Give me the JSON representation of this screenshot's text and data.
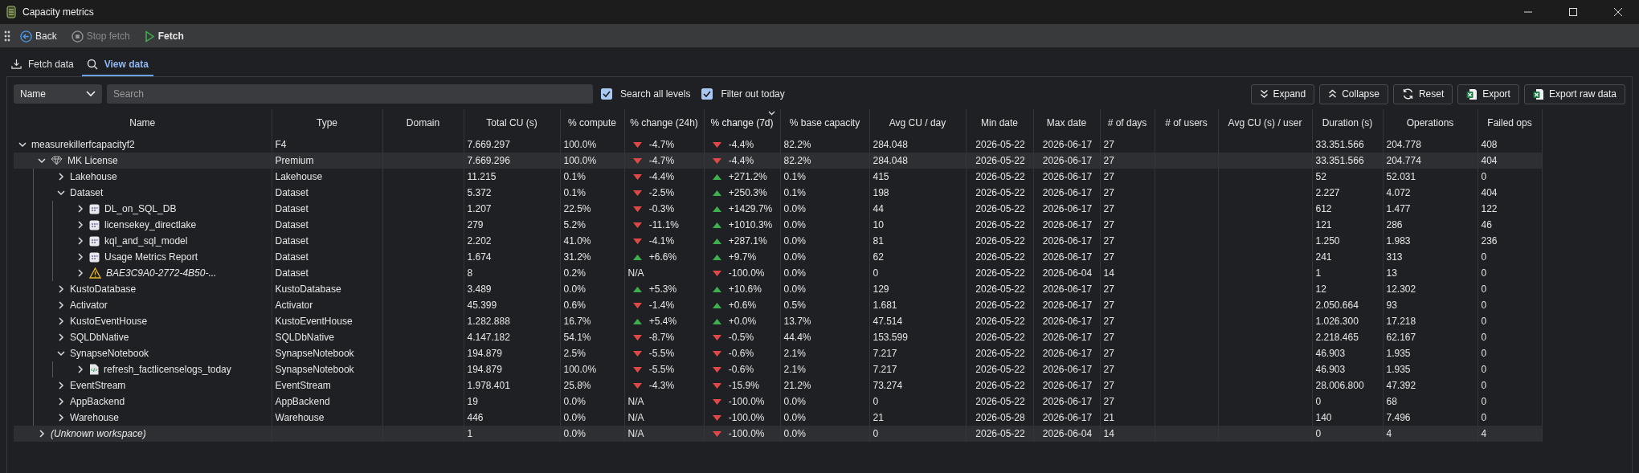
{
  "window": {
    "title": "Capacity metrics"
  },
  "toolbar": [
    {
      "label": "Back",
      "kind": "back",
      "disabled": false,
      "bold": false
    },
    {
      "label": "Stop fetch",
      "kind": "stop",
      "disabled": true,
      "bold": false
    },
    {
      "label": "Fetch",
      "kind": "fetch",
      "disabled": false,
      "bold": true
    }
  ],
  "tabs": [
    {
      "label": "Fetch data",
      "kind": "download",
      "selected": false
    },
    {
      "label": "View data",
      "kind": "search",
      "selected": true
    }
  ],
  "filter": {
    "field": "Name",
    "search_placeholder": "Search",
    "checkboxes": [
      {
        "label": "Search all levels",
        "checked": true
      },
      {
        "label": "Filter out today",
        "checked": true
      }
    ]
  },
  "actions": [
    {
      "label": "Expand",
      "kind": "expand"
    },
    {
      "label": "Collapse",
      "kind": "collapse"
    },
    {
      "label": "Reset",
      "kind": "reset"
    },
    {
      "label": "Export",
      "kind": "excel"
    },
    {
      "label": "Export raw data",
      "kind": "excel"
    }
  ],
  "table": {
    "columns": [
      {
        "label": "Name",
        "sorted": false
      },
      {
        "label": "Type",
        "sorted": false
      },
      {
        "label": "Domain",
        "sorted": false
      },
      {
        "label": "Total CU (s)",
        "sorted": false
      },
      {
        "label": "% compute",
        "sorted": false
      },
      {
        "label": "% change (24h)",
        "sorted": false
      },
      {
        "label": "% change (7d)",
        "sorted": true
      },
      {
        "label": "% base capacity",
        "sorted": false
      },
      {
        "label": "Avg CU / day",
        "sorted": false
      },
      {
        "label": "Min date",
        "sorted": false
      },
      {
        "label": "Max date",
        "sorted": false
      },
      {
        "label": "# of days",
        "sorted": false
      },
      {
        "label": "# of users",
        "sorted": false
      },
      {
        "label": "Avg CU (s) / user",
        "sorted": false
      },
      {
        "label": "Duration (s)",
        "sorted": false
      },
      {
        "label": "Operations",
        "sorted": false
      },
      {
        "label": "Failed ops",
        "sorted": false
      }
    ],
    "rows": [
      {
        "name": "measurekillerfcapacityf2",
        "expanded": true,
        "selected": false,
        "type": "F4",
        "total_cu": "7.669.297",
        "compute": "100.0%",
        "change_24h": {
          "text": "-4.7%",
          "rising": false
        },
        "change_7d": {
          "text": "-4.4%",
          "rising": false
        },
        "base_capacity": "82.2%",
        "avg_cu_day": "284.048",
        "min_date": "2026-05-22",
        "max_date": "2026-06-17",
        "days": "27",
        "duration": "33.351.566",
        "operations": "204.778",
        "failed_ops": "408",
        "children": [
          {
            "name": "MK License",
            "kind": "license",
            "expanded": true,
            "selected": true,
            "type": "Premium",
            "total_cu": "7.669.296",
            "compute": "100.0%",
            "change_24h": {
              "text": "-4.7%",
              "rising": false
            },
            "change_7d": {
              "text": "-4.4%",
              "rising": false
            },
            "base_capacity": "82.2%",
            "avg_cu_day": "284.048",
            "min_date": "2026-05-22",
            "max_date": "2026-06-17",
            "days": "27",
            "duration": "33.351.566",
            "operations": "204.774",
            "failed_ops": "404",
            "children": [
              {
                "name": "Lakehouse",
                "expanded": false,
                "selected": false,
                "type": "Lakehouse",
                "total_cu": "11.215",
                "compute": "0.1%",
                "change_24h": {
                  "text": "-4.4%",
                  "rising": false
                },
                "change_7d": {
                  "text": "+271.2%",
                  "rising": true
                },
                "base_capacity": "0.1%",
                "avg_cu_day": "415",
                "min_date": "2026-05-22",
                "max_date": "2026-06-17",
                "days": "27",
                "duration": "52",
                "operations": "52.031",
                "failed_ops": "0"
              },
              {
                "name": "Dataset",
                "expanded": true,
                "selected": false,
                "type": "Dataset",
                "total_cu": "5.372",
                "compute": "0.1%",
                "change_24h": {
                  "text": "-2.5%",
                  "rising": false
                },
                "change_7d": {
                  "text": "+250.3%",
                  "rising": true
                },
                "base_capacity": "0.1%",
                "avg_cu_day": "198",
                "min_date": "2026-05-22",
                "max_date": "2026-06-17",
                "days": "27",
                "duration": "2.227",
                "operations": "4.072",
                "failed_ops": "404",
                "children": [
                  {
                    "name": "DL_on_SQL_DB",
                    "kind": "model",
                    "expanded": false,
                    "selected": false,
                    "type": "Dataset",
                    "total_cu": "1.207",
                    "compute": "22.5%",
                    "change_24h": {
                      "text": "-0.3%",
                      "rising": false
                    },
                    "change_7d": {
                      "text": "+1429.7%",
                      "rising": true
                    },
                    "base_capacity": "0.0%",
                    "avg_cu_day": "44",
                    "min_date": "2026-05-22",
                    "max_date": "2026-06-17",
                    "days": "27",
                    "duration": "612",
                    "operations": "1.477",
                    "failed_ops": "122"
                  },
                  {
                    "name": "licensekey_directlake",
                    "kind": "model",
                    "expanded": false,
                    "selected": false,
                    "type": "Dataset",
                    "total_cu": "279",
                    "compute": "5.2%",
                    "change_24h": {
                      "text": "-11.1%",
                      "rising": false
                    },
                    "change_7d": {
                      "text": "+1010.3%",
                      "rising": true
                    },
                    "base_capacity": "0.0%",
                    "avg_cu_day": "10",
                    "min_date": "2026-05-22",
                    "max_date": "2026-06-17",
                    "days": "27",
                    "duration": "121",
                    "operations": "286",
                    "failed_ops": "46"
                  },
                  {
                    "name": "kql_and_sql_model",
                    "kind": "model",
                    "expanded": false,
                    "selected": false,
                    "type": "Dataset",
                    "total_cu": "2.202",
                    "compute": "41.0%",
                    "change_24h": {
                      "text": "-4.1%",
                      "rising": false
                    },
                    "change_7d": {
                      "text": "+287.1%",
                      "rising": true
                    },
                    "base_capacity": "0.0%",
                    "avg_cu_day": "81",
                    "min_date": "2026-05-22",
                    "max_date": "2026-06-17",
                    "days": "27",
                    "duration": "1.250",
                    "operations": "1.983",
                    "failed_ops": "236"
                  },
                  {
                    "name": "Usage Metrics Report",
                    "kind": "model",
                    "expanded": false,
                    "selected": false,
                    "type": "Dataset",
                    "total_cu": "1.674",
                    "compute": "31.2%",
                    "change_24h": {
                      "text": "+6.6%",
                      "rising": true
                    },
                    "change_7d": {
                      "text": "+9.7%",
                      "rising": true
                    },
                    "base_capacity": "0.0%",
                    "avg_cu_day": "62",
                    "min_date": "2026-05-22",
                    "max_date": "2026-06-17",
                    "days": "27",
                    "duration": "241",
                    "operations": "313",
                    "failed_ops": "0"
                  },
                  {
                    "name": "BAE3C9A0-2772-4B50-...",
                    "kind": "warning",
                    "expanded": false,
                    "selected": false,
                    "type": "Dataset",
                    "total_cu": "8",
                    "compute": "0.2%",
                    "change_24h": {
                      "text": "N/A"
                    },
                    "change_7d": {
                      "text": "-100.0%",
                      "rising": false
                    },
                    "base_capacity": "0.0%",
                    "avg_cu_day": "0",
                    "min_date": "2026-05-22",
                    "max_date": "2026-06-04",
                    "days": "14",
                    "duration": "1",
                    "operations": "13",
                    "failed_ops": "0"
                  }
                ]
              },
              {
                "name": "KustoDatabase",
                "expanded": false,
                "selected": false,
                "type": "KustoDatabase",
                "total_cu": "3.489",
                "compute": "0.0%",
                "change_24h": {
                  "text": "+5.3%",
                  "rising": true
                },
                "change_7d": {
                  "text": "+10.6%",
                  "rising": true
                },
                "base_capacity": "0.0%",
                "avg_cu_day": "129",
                "min_date": "2026-05-22",
                "max_date": "2026-06-17",
                "days": "27",
                "duration": "12",
                "operations": "12.302",
                "failed_ops": "0"
              },
              {
                "name": "Activator",
                "expanded": false,
                "selected": false,
                "type": "Activator",
                "total_cu": "45.399",
                "compute": "0.6%",
                "change_24h": {
                  "text": "-1.4%",
                  "rising": false
                },
                "change_7d": {
                  "text": "+0.6%",
                  "rising": true
                },
                "base_capacity": "0.5%",
                "avg_cu_day": "1.681",
                "min_date": "2026-05-22",
                "max_date": "2026-06-17",
                "days": "27",
                "duration": "2.050.664",
                "operations": "93",
                "failed_ops": "0"
              },
              {
                "name": "KustoEventHouse",
                "expanded": false,
                "selected": false,
                "type": "KustoEventHouse",
                "total_cu": "1.282.888",
                "compute": "16.7%",
                "change_24h": {
                  "text": "+5.4%",
                  "rising": true
                },
                "change_7d": {
                  "text": "+0.0%",
                  "rising": true
                },
                "base_capacity": "13.7%",
                "avg_cu_day": "47.514",
                "min_date": "2026-05-22",
                "max_date": "2026-06-17",
                "days": "27",
                "duration": "1.026.300",
                "operations": "17.218",
                "failed_ops": "0"
              },
              {
                "name": "SQLDbNative",
                "expanded": false,
                "selected": false,
                "type": "SQLDbNative",
                "total_cu": "4.147.182",
                "compute": "54.1%",
                "change_24h": {
                  "text": "-8.7%",
                  "rising": false
                },
                "change_7d": {
                  "text": "-0.5%",
                  "rising": false
                },
                "base_capacity": "44.4%",
                "avg_cu_day": "153.599",
                "min_date": "2026-05-22",
                "max_date": "2026-06-17",
                "days": "27",
                "duration": "2.218.465",
                "operations": "62.167",
                "failed_ops": "0"
              },
              {
                "name": "SynapseNotebook",
                "expanded": true,
                "selected": false,
                "type": "SynapseNotebook",
                "total_cu": "194.879",
                "compute": "2.5%",
                "change_24h": {
                  "text": "-5.5%",
                  "rising": false
                },
                "change_7d": {
                  "text": "-0.6%",
                  "rising": false
                },
                "base_capacity": "2.1%",
                "avg_cu_day": "7.217",
                "min_date": "2026-05-22",
                "max_date": "2026-06-17",
                "days": "27",
                "duration": "46.903",
                "operations": "1.935",
                "failed_ops": "0",
                "children": [
                  {
                    "name": "refresh_factlicenselogs_today",
                    "kind": "notebook",
                    "expanded": false,
                    "selected": false,
                    "type": "SynapseNotebook",
                    "total_cu": "194.879",
                    "compute": "100.0%",
                    "change_24h": {
                      "text": "-5.5%",
                      "rising": false
                    },
                    "change_7d": {
                      "text": "-0.6%",
                      "rising": false
                    },
                    "base_capacity": "2.1%",
                    "avg_cu_day": "7.217",
                    "min_date": "2026-05-22",
                    "max_date": "2026-06-17",
                    "days": "27",
                    "duration": "46.903",
                    "operations": "1.935",
                    "failed_ops": "0"
                  }
                ]
              },
              {
                "name": "EventStream",
                "expanded": false,
                "selected": false,
                "type": "EventStream",
                "total_cu": "1.978.401",
                "compute": "25.8%",
                "change_24h": {
                  "text": "-4.3%",
                  "rising": false
                },
                "change_7d": {
                  "text": "-15.9%",
                  "rising": false
                },
                "base_capacity": "21.2%",
                "avg_cu_day": "73.274",
                "min_date": "2026-05-22",
                "max_date": "2026-06-17",
                "days": "27",
                "duration": "28.006.800",
                "operations": "47.392",
                "failed_ops": "0"
              },
              {
                "name": "AppBackend",
                "expanded": false,
                "selected": false,
                "type": "AppBackend",
                "total_cu": "19",
                "compute": "0.0%",
                "change_24h": {
                  "text": "N/A"
                },
                "change_7d": {
                  "text": "-100.0%",
                  "rising": false
                },
                "base_capacity": "0.0%",
                "avg_cu_day": "0",
                "min_date": "2026-05-22",
                "max_date": "2026-06-17",
                "days": "27",
                "duration": "0",
                "operations": "68",
                "failed_ops": "0"
              },
              {
                "name": "Warehouse",
                "expanded": false,
                "selected": false,
                "type": "Warehouse",
                "total_cu": "446",
                "compute": "0.0%",
                "change_24h": {
                  "text": "N/A"
                },
                "change_7d": {
                  "text": "-100.0%",
                  "rising": false
                },
                "base_capacity": "0.0%",
                "avg_cu_day": "21",
                "min_date": "2026-05-28",
                "max_date": "2026-06-17",
                "days": "21",
                "duration": "140",
                "operations": "7.496",
                "failed_ops": "0"
              }
            ]
          },
          {
            "name": "(Unknown workspace)",
            "kind": "unknown",
            "expanded": false,
            "selected": true,
            "total_cu": "1",
            "compute": "0.0%",
            "change_24h": {
              "text": "N/A"
            },
            "change_7d": {
              "text": "-100.0%",
              "rising": false
            },
            "base_capacity": "0.0%",
            "avg_cu_day": "0",
            "min_date": "2026-05-22",
            "max_date": "2026-06-04",
            "days": "14",
            "duration": "0",
            "operations": "4",
            "failed_ops": "4"
          }
        ]
      }
    ]
  }
}
